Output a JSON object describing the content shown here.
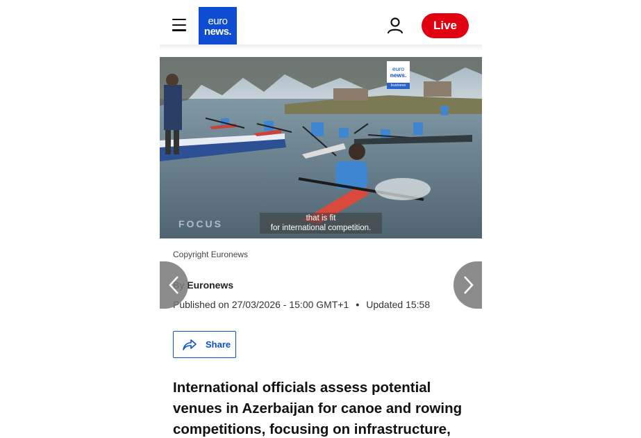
{
  "header": {
    "logo_line1": "euro",
    "logo_line2": "news.",
    "live_label": "Live",
    "brand_color": "#0d4cd3",
    "live_color": "#e1000f",
    "icons": [
      "menu-icon",
      "user-icon"
    ]
  },
  "hero": {
    "badge_line1": "euro",
    "badge_line2": "news.",
    "badge_sub": "business",
    "watermark": "FOCUS",
    "subtitle_line1": "that is fit",
    "subtitle_line2": "for international competition."
  },
  "article": {
    "copyright": "Copyright Euronews",
    "by_prefix": "By ",
    "author": "Euronews",
    "published": "Published on 27/03/2026 - 15:00 GMT+1",
    "dot": "•",
    "updated": "Updated 15:58",
    "share_label": "Share",
    "headline": "International officials assess potential venues in Azerbaijan for canoe and rowing competitions, focusing on infrastructure,"
  },
  "carousel": {
    "prev_icon": "chevron-left-icon",
    "next_icon": "chevron-right-icon"
  }
}
